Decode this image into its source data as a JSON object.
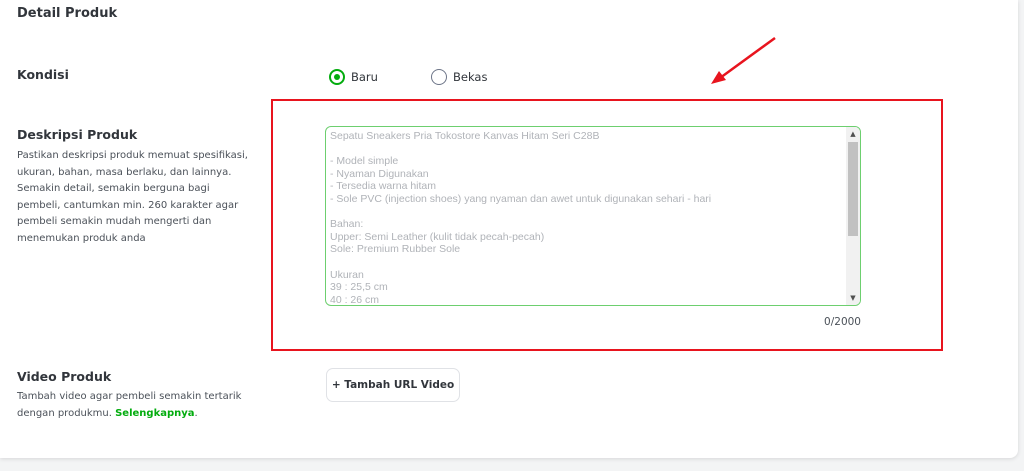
{
  "section_title": "Detail Produk",
  "kondisi": {
    "label": "Kondisi",
    "options": [
      "Baru",
      "Bekas"
    ],
    "selected": "Baru"
  },
  "deskripsi": {
    "label": "Deskripsi Produk",
    "help": "Pastikan deskripsi produk memuat spesifikasi, ukuran, bahan, masa berlaku, dan lainnya. Semakin detail, semakin berguna bagi pembeli, cantumkan min. 260 karakter agar pembeli semakin mudah mengerti dan menemukan produk anda",
    "placeholder": "Sepatu Sneakers Pria Tokostore Kanvas Hitam Seri C28B\n\n- Model simple\n- Nyaman Digunakan\n- Tersedia warna hitam\n- Sole PVC (injection shoes) yang nyaman dan awet untuk digunakan sehari - hari\n\nBahan:\nUpper: Semi Leather (kulit tidak pecah-pecah)\nSole: Premium Rubber Sole\n\nUkuran\n39 : 25,5 cm\n40 : 26 cm",
    "counter": "0/2000"
  },
  "video": {
    "label": "Video Produk",
    "help": "Tambah video agar pembeli semakin tertarik dengan produkmu.",
    "link": "Selengkapnya",
    "link_suffix": ".",
    "button_label": "+ Tambah URL Video"
  },
  "colors": {
    "accent": "#03ac0e",
    "highlight": "#e8141e",
    "textarea_border": "#6dcf6f"
  }
}
